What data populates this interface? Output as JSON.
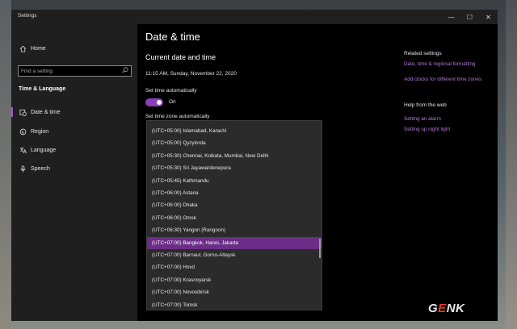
{
  "window": {
    "title": "Settings"
  },
  "window_controls": {
    "minimize": "—",
    "maximize": "☐",
    "close": "✕"
  },
  "sidebar": {
    "home": {
      "label": "Home",
      "icon": "home-icon"
    },
    "search": {
      "placeholder": "Find a setting",
      "icon": "search-icon"
    },
    "section_title": "Time & Language",
    "items": [
      {
        "label": "Date & time",
        "icon": "calendar-clock-icon",
        "selected": true
      },
      {
        "label": "Region",
        "icon": "globe-icon",
        "selected": false
      },
      {
        "label": "Language",
        "icon": "language-icon",
        "selected": false
      },
      {
        "label": "Speech",
        "icon": "microphone-icon",
        "selected": false
      }
    ]
  },
  "main": {
    "title": "Date & time",
    "subtitle": "Current date and time",
    "current_datetime": "11:15 AM, Sunday, November 22, 2020",
    "set_time_auto_label": "Set time automatically",
    "set_time_auto_state": "On",
    "set_timezone_auto_label": "Set time zone automatically"
  },
  "timezones": [
    "(UTC+05:00) Islamabad, Karachi",
    "(UTC+05:00) Qyzylorda",
    "(UTC+05:30) Chennai, Kolkata, Mumbai, New Delhi",
    "(UTC+05:30) Sri Jayawardenepura",
    "(UTC+05:45) Kathmandu",
    "(UTC+06:00) Astana",
    "(UTC+06:00) Dhaka",
    "(UTC+06:00) Omsk",
    "(UTC+06:30) Yangon (Rangoon)",
    "(UTC+07:00) Bangkok, Hanoi, Jakarta",
    "(UTC+07:00) Barnaul, Gorno-Altaysk",
    "(UTC+07:00) Hovd",
    "(UTC+07:00) Krasnoyarsk",
    "(UTC+07:00) Novosibirsk",
    "(UTC+07:00) Tomsk"
  ],
  "selected_timezone": "(UTC+07:00) Bangkok, Hanoi, Jakarta",
  "related": {
    "heading": "Related settings",
    "links": [
      "Date, time & regional formatting",
      "Add clocks for different time zones"
    ]
  },
  "help": {
    "heading": "Help from the web",
    "links": [
      "Setting an alarm",
      "Setting up night light"
    ]
  },
  "watermark": {
    "prefix": "G",
    "accent": "E",
    "suffix": "NK"
  },
  "colors": {
    "accent": "#8a3fb8",
    "link": "#b07ad6",
    "selection": "#6b2d86"
  }
}
